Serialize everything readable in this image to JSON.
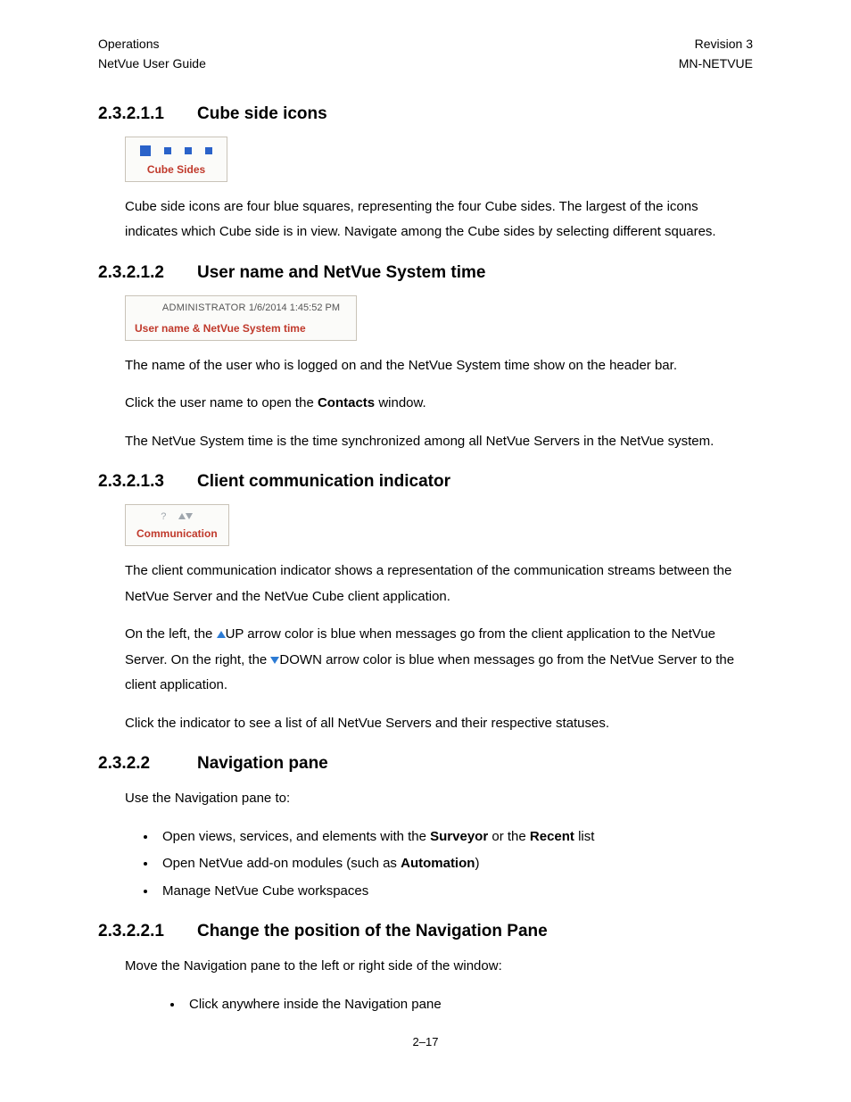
{
  "header": {
    "left_line1": "Operations",
    "left_line2": "NetVue User Guide",
    "right_line1": "Revision 3",
    "right_line2": "MN-NETVUE"
  },
  "sections": {
    "s1": {
      "num": "2.3.2.1.1",
      "title": "Cube side icons"
    },
    "s2": {
      "num": "2.3.2.1.2",
      "title": "User name and NetVue System time"
    },
    "s3": {
      "num": "2.3.2.1.3",
      "title": "Client communication indicator"
    },
    "s4": {
      "num": "2.3.2.2",
      "title": "Navigation pane"
    },
    "s5": {
      "num": "2.3.2.2.1",
      "title": "Change the position of the Navigation Pane"
    }
  },
  "fig1_caption": "Cube Sides",
  "s1_p1": "Cube side icons are four blue squares, representing the four Cube sides. The largest of the icons indicates which Cube side is in view. Navigate among the Cube sides by selecting different squares.",
  "fig2": {
    "user": "ADMINISTRATOR",
    "time": "1/6/2014 1:45:52 PM",
    "caption": "User name & NetVue System time"
  },
  "s2_p1": "The name of the user who is logged on and the NetVue System time show on the header bar.",
  "s2_p2a": "Click the user name to open the ",
  "s2_p2b": "Contacts",
  "s2_p2c": " window.",
  "s2_p3": "The NetVue System time is the time synchronized among all NetVue Servers in the NetVue system.",
  "fig3": {
    "question": "?",
    "caption": "Communication"
  },
  "s3_p1": "The client communication indicator shows a representation of the communication streams between the NetVue Server and the NetVue Cube client application.",
  "s3_p2a": "On the left, the ",
  "s3_p2b": "UP arrow color is blue when messages go from the client application to the NetVue Server. On the right, the ",
  "s3_p2c": "DOWN arrow color is blue when messages go from the NetVue Server to the client application.",
  "s3_p3": "Click the indicator to see a list of all NetVue Servers and their respective statuses.",
  "s4_p1": "Use the Navigation pane to:",
  "s4_li1a": "Open views, services, and elements with the ",
  "s4_li1b": "Surveyor",
  "s4_li1c": " or the ",
  "s4_li1d": "Recent",
  "s4_li1e": " list",
  "s4_li2a": "Open NetVue add-on modules (such as ",
  "s4_li2b": "Automation",
  "s4_li2c": ")",
  "s4_li3": "Manage NetVue Cube workspaces",
  "s5_p1": "Move the Navigation pane to the left or right side of the window:",
  "s5_li1": "Click anywhere inside the Navigation pane",
  "page_number": "2–17"
}
